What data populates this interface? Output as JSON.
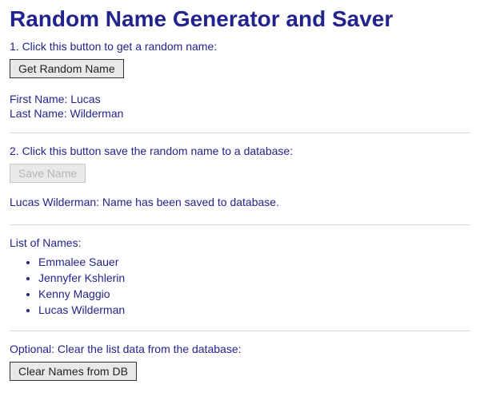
{
  "title": "Random Name Generator and Saver",
  "section1": {
    "instruction": "1. Click this button to get a random name:",
    "button": "Get Random Name",
    "firstNameLabel": "First Name: ",
    "firstName": "Lucas",
    "lastNameLabel": "Last Name: ",
    "lastName": "Wilderman"
  },
  "section2": {
    "instruction": "2. Click this button save the random name to a database:",
    "button": "Save Name",
    "status": "Lucas Wilderman: Name has been saved to database."
  },
  "section3": {
    "heading": "List of Names:",
    "names": [
      "Emmalee Sauer",
      "Jennyfer Kshlerin",
      "Kenny Maggio",
      "Lucas Wilderman"
    ]
  },
  "section4": {
    "instruction": "Optional: Clear the list data from the database:",
    "button": "Clear Names from DB"
  }
}
